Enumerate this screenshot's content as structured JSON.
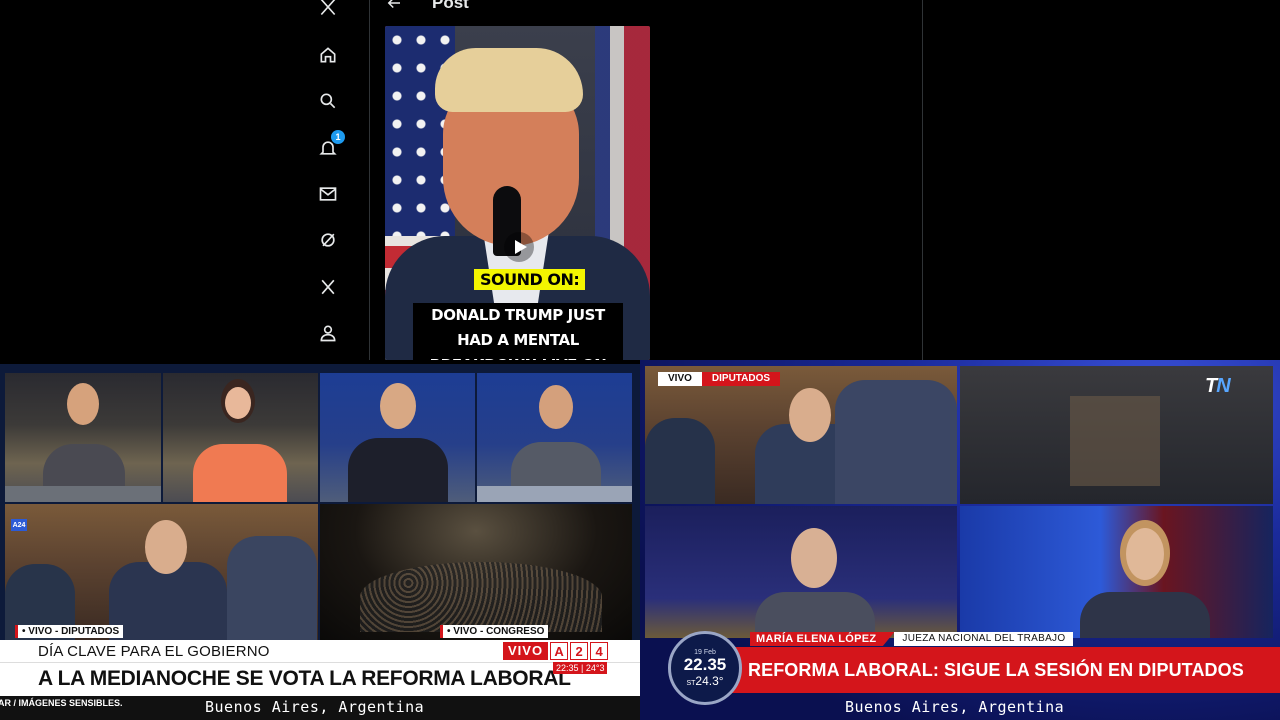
{
  "x_app": {
    "nav_icons": [
      "x-logo-icon",
      "home-icon",
      "search-icon",
      "notifications-icon",
      "messages-icon",
      "grok-icon",
      "premium-x-icon",
      "profile-icon"
    ],
    "notification_count": "1",
    "post_header": {
      "title": "Post"
    },
    "video": {
      "caption_label": "SOUND ON:",
      "caption_text": "DONALD TRUMP JUST HAD A MENTAL BREAKDOWN LIVE ON TELEVISION"
    }
  },
  "a24": {
    "logo": "A24",
    "tiles": [
      {
        "chip": "• VIVO - DIPUTADOS"
      },
      {
        "chip": "• VIVO - CONGRESO"
      }
    ],
    "kicker": "DÍA CLAVE PARA EL GOBIERNO",
    "live": {
      "vivo": "VIVO",
      "a": "A",
      "n2": "2",
      "n4": "4"
    },
    "headline": "A LA MEDIANOCHE SE VOTA LA REFORMA LABORAL",
    "time": "22:35 | 24°3",
    "ticker": "AR / IMÁGENES SENSIBLES.",
    "location": "Buenos Aires, Argentina"
  },
  "tn": {
    "vivo": "VIVO",
    "section": "DIPUTADOS",
    "logo_t": "T",
    "logo_n": "N",
    "name": "MARÍA ELENA LÓPEZ",
    "role": "JUEZA NACIONAL DEL TRABAJO",
    "headline": "REFORMA LABORAL: SIGUE LA SESIÓN EN DIPUTADOS",
    "clock": {
      "date": "19 Feb",
      "time": "22.35",
      "temp": "24.3°",
      "temp_prefix": "ST"
    },
    "location": "Buenos Aires, Argentina"
  },
  "colors": {
    "accent_red": "#d4151b",
    "x_blue": "#1d9bf0",
    "caption_yellow": "#f3f500"
  }
}
